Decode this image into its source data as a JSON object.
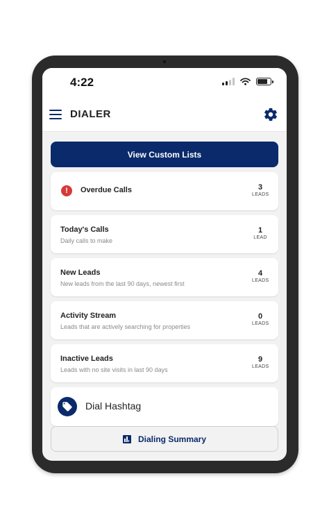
{
  "status": {
    "time": "4:22"
  },
  "header": {
    "title": "DIALER"
  },
  "primary_button": {
    "label": "View Custom Lists"
  },
  "lists": [
    {
      "title": "Overdue Calls",
      "subtitle": "",
      "count": "3",
      "unit": "LEADS",
      "icon": "alert-icon"
    },
    {
      "title": "Today's Calls",
      "subtitle": "Daily calls to make",
      "count": "1",
      "unit": "LEAD"
    },
    {
      "title": "New Leads",
      "subtitle": "New leads from the last 90 days, newest first",
      "count": "4",
      "unit": "LEADS"
    },
    {
      "title": "Activity Stream",
      "subtitle": "Leads that are actively searching for properties",
      "count": "0",
      "unit": "LEADS"
    },
    {
      "title": "Inactive Leads",
      "subtitle": "Leads with no site visits in last 90 days",
      "count": "9",
      "unit": "LEADS"
    }
  ],
  "hashtag": {
    "label": "Dial Hashtag",
    "icon": "tag-icon"
  },
  "summary": {
    "label": "Dialing Summary",
    "icon": "bar-chart-icon"
  },
  "colors": {
    "brand": "#0b2a6b",
    "alert": "#d63a3a",
    "background": "#f2f2f2"
  }
}
